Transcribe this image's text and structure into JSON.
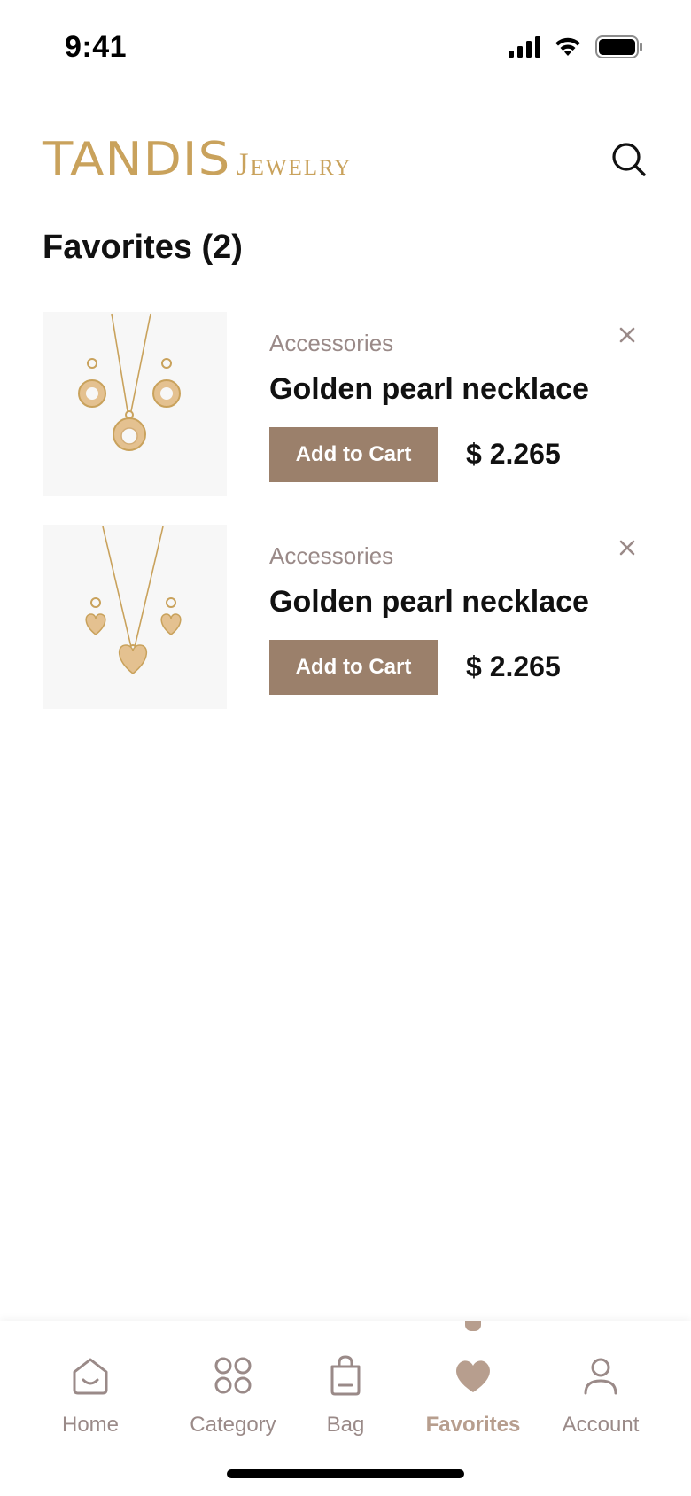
{
  "status_bar": {
    "time": "9:41"
  },
  "brand": {
    "name": "TANDIS",
    "sub": "Jewelry"
  },
  "page": {
    "title": "Favorites (2)"
  },
  "favorites": [
    {
      "category": "Accessories",
      "name": "Golden pearl necklace",
      "button": "Add to Cart",
      "price": "$ 2.265",
      "image": "round-pendant-earrings"
    },
    {
      "category": "Accessories",
      "name": "Golden pearl necklace",
      "button": "Add to Cart",
      "price": "$ 2.265",
      "image": "heart-pendant-earrings"
    }
  ],
  "tabbar": {
    "tabs": [
      {
        "label": "Home",
        "icon": "home-icon"
      },
      {
        "label": "Category",
        "icon": "category-icon"
      },
      {
        "label": "Bag",
        "icon": "bag-icon"
      },
      {
        "label": "Favorites",
        "icon": "heart-icon",
        "active": true
      },
      {
        "label": "Account",
        "icon": "account-icon"
      }
    ]
  },
  "colors": {
    "brand_gold": "#c9a25c",
    "accent_brown": "#9b806b",
    "muted": "#9a8a88",
    "active_tab": "#b79e8e"
  }
}
